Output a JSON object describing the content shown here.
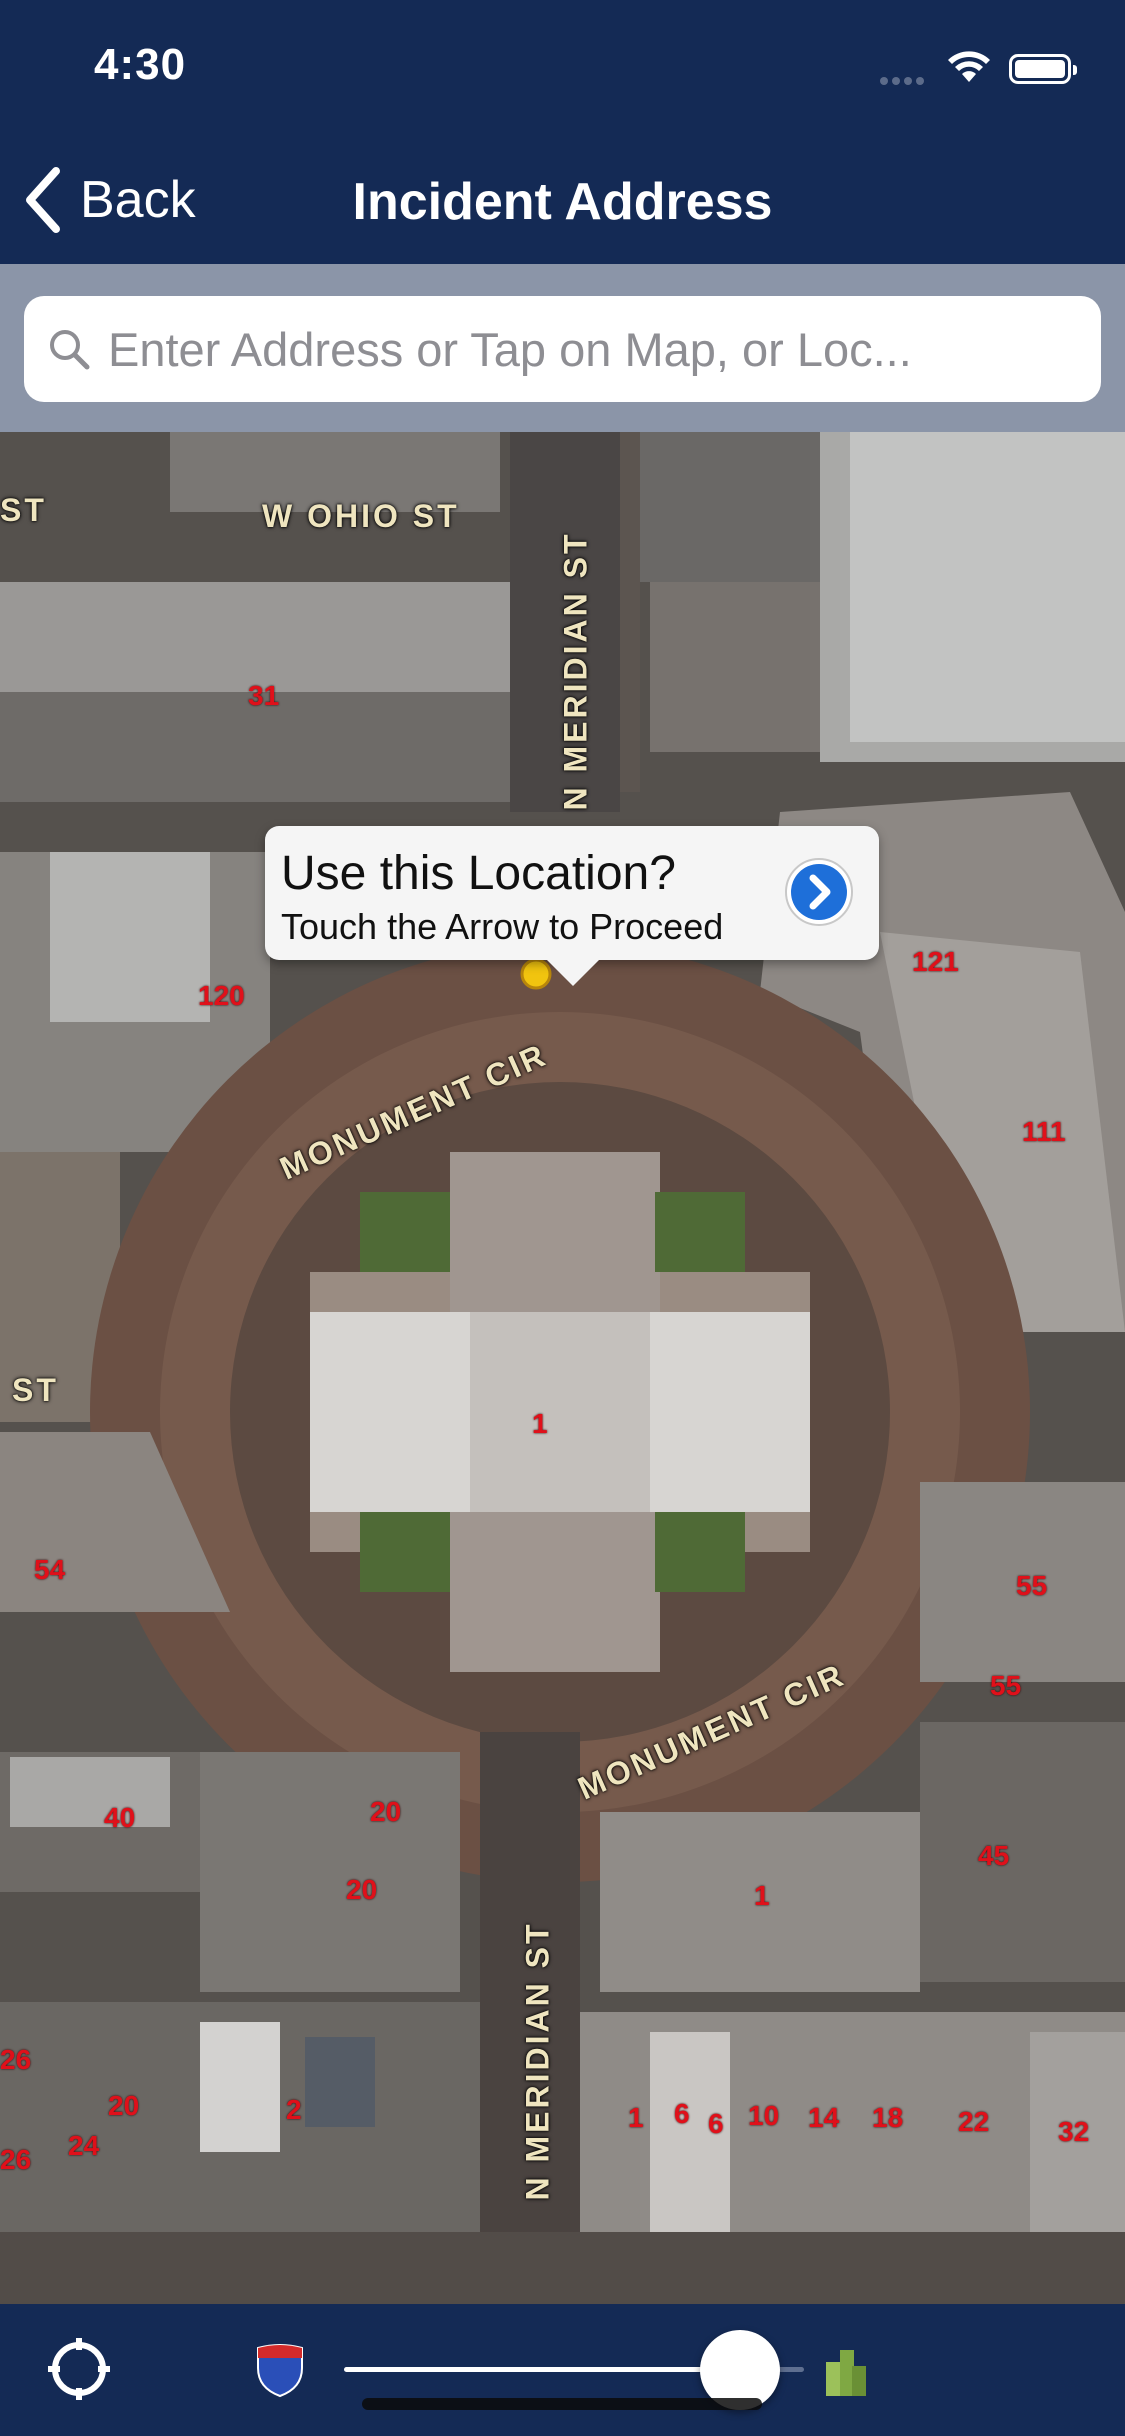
{
  "status_bar": {
    "time": "4:30"
  },
  "nav": {
    "back_label": "Back",
    "title": "Incident Address"
  },
  "search": {
    "placeholder": "Enter Address or Tap on Map, or Loc...",
    "value": ""
  },
  "map": {
    "street_labels": [
      "ST",
      "W OHIO ST",
      "N MERIDIAN ST",
      "MONUMENT CIR",
      "ST",
      "MONUMENT CIR",
      "N MERIDIAN ST"
    ],
    "address_numbers": [
      "31",
      "120",
      "121",
      "111",
      "1",
      "54",
      "55",
      "55",
      "40",
      "20",
      "20",
      "45",
      "1",
      "26",
      "20",
      "24",
      "26",
      "2",
      "1",
      "6",
      "6",
      "10",
      "14",
      "18",
      "22",
      "32"
    ]
  },
  "callout": {
    "title": "Use this Location?",
    "subtitle": "Touch the Arrow to Proceed"
  },
  "toolbar": {
    "map_type_slider": {
      "value_percent": 95,
      "left_icon": "interstate-shield-icon",
      "right_icon": "buildings-icon"
    },
    "locate_icon": "crosshair-icon"
  },
  "colors": {
    "nav_background": "#142a55",
    "callout_arrow": "#1e6fd9",
    "address_number": "#e0101a"
  }
}
